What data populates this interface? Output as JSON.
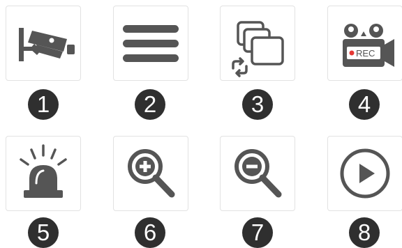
{
  "colors": {
    "icon": "#555555",
    "badge_bg": "#2f2f2f",
    "badge_text": "#ffffff",
    "tile_border": "#e2e2e2",
    "rec_dot": "#e53935"
  },
  "icons": [
    {
      "number": "1",
      "icon": "security-camera-icon"
    },
    {
      "number": "2",
      "icon": "hamburger-menu-icon"
    },
    {
      "number": "3",
      "icon": "cycle-views-icon"
    },
    {
      "number": "4",
      "icon": "record-camera-icon",
      "label": "REC"
    },
    {
      "number": "5",
      "icon": "alarm-siren-icon"
    },
    {
      "number": "6",
      "icon": "zoom-in-icon"
    },
    {
      "number": "7",
      "icon": "zoom-out-icon"
    },
    {
      "number": "8",
      "icon": "play-icon"
    }
  ]
}
